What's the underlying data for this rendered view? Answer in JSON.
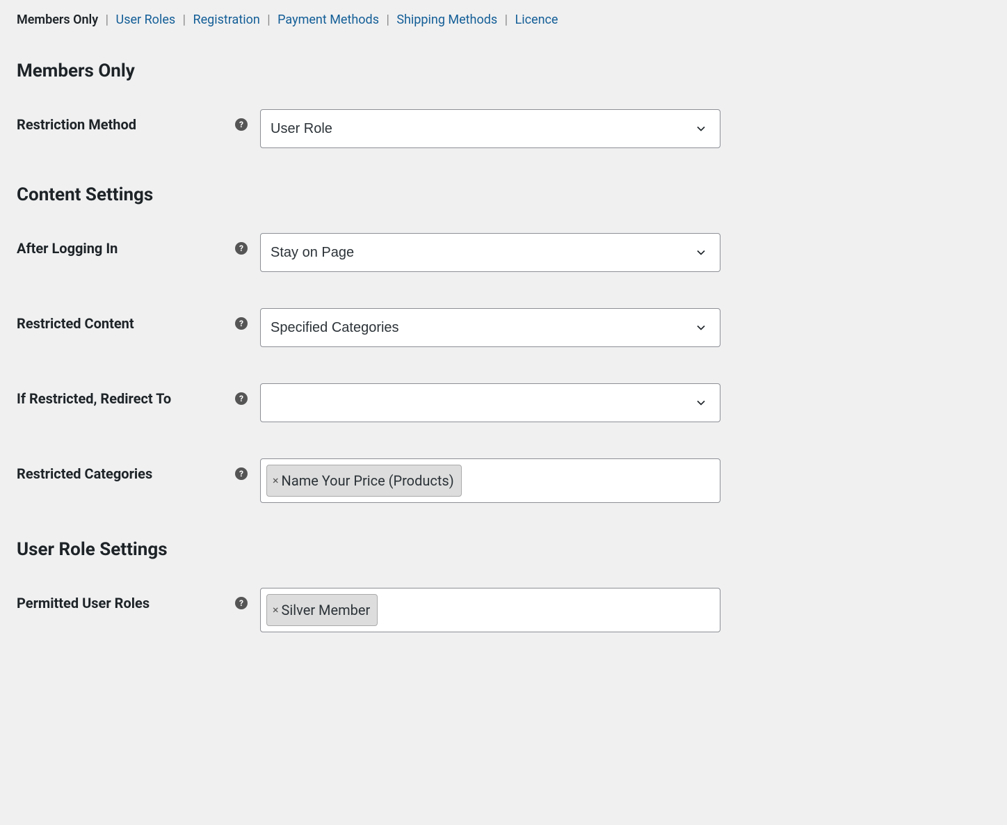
{
  "tabs": [
    {
      "label": "Members Only",
      "active": true
    },
    {
      "label": "User Roles",
      "active": false
    },
    {
      "label": "Registration",
      "active": false
    },
    {
      "label": "Payment Methods",
      "active": false
    },
    {
      "label": "Shipping Methods",
      "active": false
    },
    {
      "label": "Licence",
      "active": false
    }
  ],
  "page_title": "Members Only",
  "sections": {
    "main": {
      "restriction_method": {
        "label": "Restriction Method",
        "value": "User Role"
      }
    },
    "content_settings": {
      "title": "Content Settings",
      "after_logging_in": {
        "label": "After Logging In",
        "value": "Stay on Page"
      },
      "restricted_content": {
        "label": "Restricted Content",
        "value": "Specified Categories"
      },
      "if_restricted_redirect_to": {
        "label": "If Restricted, Redirect To",
        "value": ""
      },
      "restricted_categories": {
        "label": "Restricted Categories",
        "tags": [
          "Name Your Price (Products)"
        ]
      }
    },
    "user_role_settings": {
      "title": "User Role Settings",
      "permitted_user_roles": {
        "label": "Permitted User Roles",
        "tags": [
          "Silver Member"
        ]
      }
    }
  }
}
